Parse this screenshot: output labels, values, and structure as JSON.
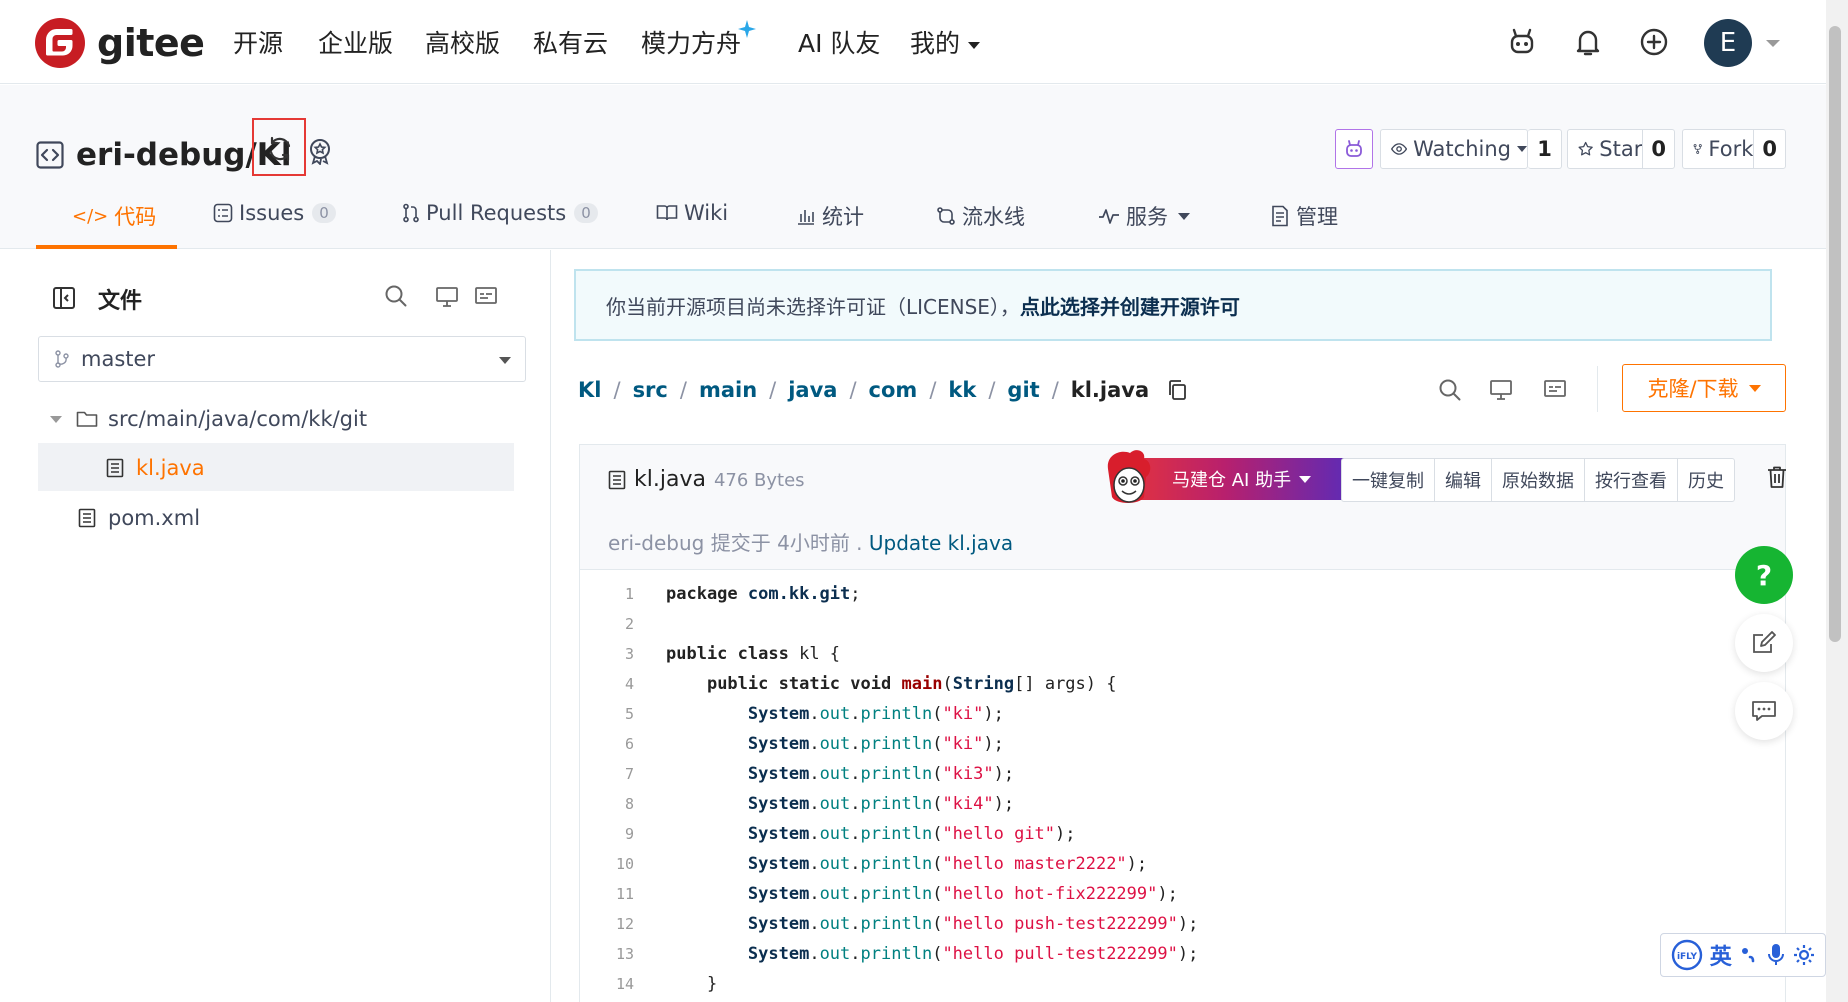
{
  "brand": {
    "name": "gitee"
  },
  "nav": {
    "items": [
      {
        "label": "开源"
      },
      {
        "label": "企业版"
      },
      {
        "label": "高校版"
      },
      {
        "label": "私有云"
      },
      {
        "label": "模力方舟"
      },
      {
        "label": "AI 队友"
      },
      {
        "label": "我的"
      }
    ],
    "avatar_initial": "E"
  },
  "repo": {
    "name": "eri-debug/Kl",
    "watch_label": "Watching",
    "watch_count": "1",
    "star_label": "Star",
    "star_count": "0",
    "fork_label": "Fork",
    "fork_count": "0"
  },
  "tabs": [
    {
      "label": "代码",
      "active": true
    },
    {
      "label": "Issues",
      "badge": "0"
    },
    {
      "label": "Pull Requests",
      "badge": "0"
    },
    {
      "label": "Wiki"
    },
    {
      "label": "统计"
    },
    {
      "label": "流水线"
    },
    {
      "label": "服务"
    },
    {
      "label": "管理"
    }
  ],
  "sidebar": {
    "title": "文件",
    "branch": "master",
    "tree": [
      {
        "label": "src/main/java/com/kk/git"
      },
      {
        "label": "kl.java"
      },
      {
        "label": "pom.xml"
      }
    ]
  },
  "license": {
    "text": "你当前开源项目尚未选择许可证（LICENSE），",
    "link": "点此选择并创建开源许可"
  },
  "breadcrumb": [
    "Kl",
    "src",
    "main",
    "java",
    "com",
    "kk",
    "git",
    "kl.java"
  ],
  "clone_label": "克隆/下载",
  "file": {
    "name": "kl.java",
    "size": "476 Bytes",
    "ai_label": "马建仓 AI 助手",
    "actions": [
      "一键复制",
      "编辑",
      "原始数据",
      "按行查看",
      "历史"
    ],
    "commit_author": "eri-debug",
    "commit_text": "提交于 4小时前 .",
    "commit_msg": "Update kl.java"
  },
  "code_lines": [
    "package com.kk.git;",
    "",
    "public class kl {",
    "    public static void main(String[] args) {",
    "        System.out.println(\"ki\");",
    "        System.out.println(\"ki\");",
    "        System.out.println(\"ki3\");",
    "        System.out.println(\"ki4\");",
    "        System.out.println(\"hello git\");",
    "        System.out.println(\"hello master2222\");",
    "        System.out.println(\"hello hot-fix222299\");",
    "        System.out.println(\"hello push-test222299\");",
    "        System.out.println(\"hello pull-test222299\");",
    "    }"
  ],
  "ifly": {
    "lang": "英"
  },
  "colors": {
    "accent": "#fe7300",
    "link": "#005980",
    "help_green": "#16b532"
  }
}
